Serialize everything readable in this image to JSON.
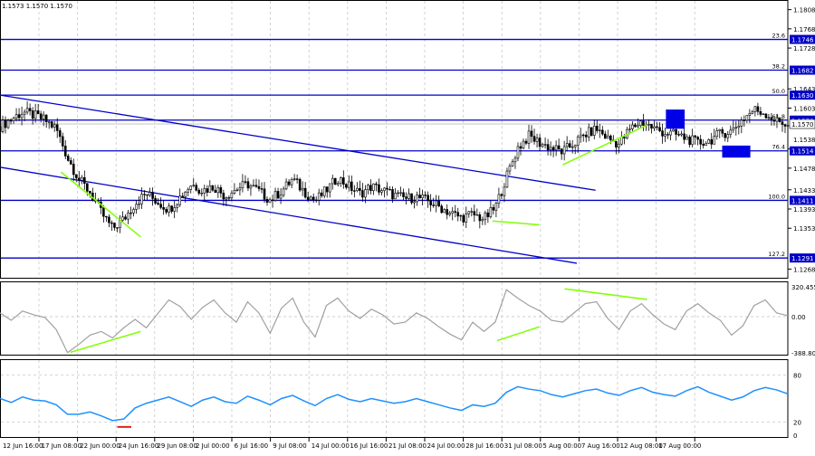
{
  "header": {
    "ohlc": "1.1573 1.1570 1.1570"
  },
  "colors": {
    "price_bar": "#000000",
    "horizontal_level": "#0000c8",
    "channel": "#0000c8",
    "divergence": "#7fff00",
    "cci_line": "#a0a0a0",
    "rsi_line": "#1e90ff",
    "box": "#0000e6",
    "red_marker": "#e02020",
    "grid": "#c8c8c8"
  },
  "chart_data": [
    {
      "type": "candlestick",
      "title": "",
      "xlabel": "",
      "ylabel": "",
      "ylim": [
        1.1248,
        1.1828
      ],
      "y_ticks": [
        "1.1808",
        "1.1768",
        "1.1728",
        "1.1643",
        "1.1603",
        "1.1518",
        "1.1478",
        "1.1433",
        "1.1393",
        "1.1353",
        "1.1268"
      ],
      "x_ticks": [
        "12 Jun 16:00",
        "17 Jun 08:00",
        "22 Jun 00:00",
        "24 Jun 16:00",
        "29 Jun 08:00",
        "2 Jul 00:00",
        "6 Jul 16:00",
        "9 Jul 08:00",
        "14 Jul 00:00",
        "16 Jul 16:00",
        "21 Jul 08:00",
        "24 Jul 00:00",
        "28 Jul 16:00",
        "31 Jul 08:00",
        "5 Aug 00:00",
        "7 Aug 16:00",
        "12 Aug 08:00",
        "17 Aug 00:00"
      ],
      "close_path": [
        [
          0,
          1.1565
        ],
        [
          1.2,
          1.158
        ],
        [
          2.4,
          1.1595
        ],
        [
          3.6,
          1.1588
        ],
        [
          4.8,
          1.1578
        ],
        [
          6,
          1.156
        ],
        [
          7.2,
          1.15
        ],
        [
          8.4,
          1.1455
        ],
        [
          9.6,
          1.1428
        ],
        [
          10.8,
          1.1385
        ],
        [
          12,
          1.1352
        ],
        [
          13.2,
          1.1372
        ],
        [
          14.4,
          1.1405
        ],
        [
          15.6,
          1.1425
        ],
        [
          16.8,
          1.1408
        ],
        [
          18,
          1.1392
        ],
        [
          19.2,
          1.1418
        ],
        [
          20.4,
          1.1445
        ],
        [
          21.6,
          1.1432
        ],
        [
          22.8,
          1.144
        ],
        [
          24,
          1.142
        ],
        [
          25.2,
          1.1435
        ],
        [
          26.4,
          1.1445
        ],
        [
          27.6,
          1.143
        ],
        [
          28.8,
          1.1412
        ],
        [
          30,
          1.143
        ],
        [
          31.2,
          1.1455
        ],
        [
          32.4,
          1.143
        ],
        [
          33.6,
          1.141
        ],
        [
          34.8,
          1.1432
        ],
        [
          36,
          1.1458
        ],
        [
          37.2,
          1.144
        ],
        [
          38.4,
          1.1425
        ],
        [
          39.6,
          1.144
        ],
        [
          40.8,
          1.1432
        ],
        [
          42,
          1.1422
        ],
        [
          43.2,
          1.1415
        ],
        [
          44.4,
          1.1418
        ],
        [
          45.6,
          1.141
        ],
        [
          46.8,
          1.1398
        ],
        [
          48,
          1.1385
        ],
        [
          49.2,
          1.1375
        ],
        [
          50.4,
          1.1382
        ],
        [
          51.6,
          1.1372
        ],
        [
          52.8,
          1.1395
        ],
        [
          54,
          1.146
        ],
        [
          55.2,
          1.152
        ],
        [
          56.4,
          1.1545
        ],
        [
          57.6,
          1.153
        ],
        [
          58.8,
          1.152
        ],
        [
          60,
          1.1512
        ],
        [
          61.2,
          1.153
        ],
        [
          62.4,
          1.1548
        ],
        [
          63.6,
          1.156
        ],
        [
          64.8,
          1.154
        ],
        [
          66,
          1.1528
        ],
        [
          67.2,
          1.156
        ],
        [
          68.4,
          1.1575
        ],
        [
          69.6,
          1.1562
        ],
        [
          70.8,
          1.1552
        ],
        [
          72,
          1.1548
        ],
        [
          73.2,
          1.154
        ],
        [
          74.4,
          1.153
        ],
        [
          75.6,
          1.1535
        ],
        [
          76.8,
          1.155
        ],
        [
          78,
          1.1555
        ],
        [
          79.2,
          1.158
        ],
        [
          80.4,
          1.16
        ],
        [
          81.6,
          1.1592
        ],
        [
          82.8,
          1.1575
        ],
        [
          84,
          1.157
        ]
      ],
      "horizontal_levels": [
        {
          "value": 1.1746,
          "label": "1.1746",
          "fib": "23.6"
        },
        {
          "value": 1.1682,
          "label": "1.1682",
          "fib": "38.2"
        },
        {
          "value": 1.163,
          "label": "1.1630",
          "fib": "50.0"
        },
        {
          "value": 1.1578,
          "label": "1.1578",
          "fib": "61.8"
        },
        {
          "value": 1.1514,
          "label": "1.1514",
          "fib": "76.4"
        },
        {
          "value": 1.1411,
          "label": "1.1411",
          "fib": "100.0"
        },
        {
          "value": 1.1291,
          "label": "1.1291",
          "fib": "127.2"
        }
      ],
      "channel_lines": [
        {
          "from": [
            0,
            1.163
          ],
          "to": [
            63.5,
            1.1432
          ]
        },
        {
          "from": [
            0,
            1.148
          ],
          "to": [
            61.5,
            1.128
          ]
        }
      ],
      "divergence_lines": [
        {
          "from": [
            6.5,
            1.147
          ],
          "to": [
            15,
            1.1335
          ]
        },
        {
          "from": [
            52.5,
            1.1368
          ],
          "to": [
            57.5,
            1.136
          ]
        },
        {
          "from": [
            60,
            1.1485
          ],
          "to": [
            69,
            1.1568
          ]
        }
      ],
      "boxes": [
        {
          "x0": 71,
          "x1": 73,
          "y0": 1.156,
          "y1": 1.16
        },
        {
          "x0": 77,
          "x1": 80,
          "y0": 1.15,
          "y1": 1.1525
        }
      ],
      "current_price": {
        "value": 1.157,
        "label": "1.1570"
      },
      "extra_price_labels": [
        {
          "value": 1.1538,
          "label": "1.1538"
        }
      ]
    },
    {
      "type": "line",
      "title": "",
      "xlabel": "",
      "ylabel": "",
      "ylim": [
        -420,
        380
      ],
      "y_ticks": [
        "320.4558",
        "0.00",
        "-388.803"
      ],
      "series": [
        {
          "values": [
            [
              0,
              40
            ],
            [
              1.2,
              -40
            ],
            [
              2.4,
              60
            ],
            [
              3.6,
              20
            ],
            [
              4.8,
              -10
            ],
            [
              6,
              -140
            ],
            [
              7.2,
              -388
            ],
            [
              8.4,
              -300
            ],
            [
              9.6,
              -200
            ],
            [
              10.8,
              -160
            ],
            [
              12,
              -230
            ],
            [
              13.2,
              -120
            ],
            [
              14.4,
              -30
            ],
            [
              15.6,
              -120
            ],
            [
              16.8,
              30
            ],
            [
              18,
              180
            ],
            [
              19.2,
              110
            ],
            [
              20.4,
              -30
            ],
            [
              21.6,
              100
            ],
            [
              22.8,
              180
            ],
            [
              24,
              40
            ],
            [
              25.2,
              -60
            ],
            [
              26.4,
              160
            ],
            [
              27.6,
              40
            ],
            [
              28.8,
              -180
            ],
            [
              30,
              90
            ],
            [
              31.2,
              200
            ],
            [
              32.4,
              -60
            ],
            [
              33.6,
              -220
            ],
            [
              34.8,
              120
            ],
            [
              36,
              200
            ],
            [
              37.2,
              60
            ],
            [
              38.4,
              -20
            ],
            [
              39.6,
              80
            ],
            [
              40.8,
              20
            ],
            [
              42,
              -80
            ],
            [
              43.2,
              -60
            ],
            [
              44.4,
              40
            ],
            [
              45.6,
              -20
            ],
            [
              46.8,
              -110
            ],
            [
              48,
              -190
            ],
            [
              49.2,
              -250
            ],
            [
              50.4,
              -60
            ],
            [
              51.6,
              -160
            ],
            [
              52.8,
              -60
            ],
            [
              54,
              290
            ],
            [
              55.2,
              200
            ],
            [
              56.4,
              120
            ],
            [
              57.6,
              60
            ],
            [
              58.8,
              -40
            ],
            [
              60,
              -60
            ],
            [
              61.2,
              40
            ],
            [
              62.4,
              140
            ],
            [
              63.6,
              160
            ],
            [
              64.8,
              -20
            ],
            [
              66,
              -140
            ],
            [
              67.2,
              60
            ],
            [
              68.4,
              140
            ],
            [
              69.6,
              20
            ],
            [
              70.8,
              -80
            ],
            [
              72,
              -140
            ],
            [
              73.2,
              60
            ],
            [
              74.4,
              140
            ],
            [
              75.6,
              40
            ],
            [
              76.8,
              -40
            ],
            [
              78,
              -200
            ],
            [
              79.2,
              -100
            ],
            [
              80.4,
              120
            ],
            [
              81.6,
              180
            ],
            [
              82.8,
              40
            ],
            [
              84,
              10
            ]
          ]
        }
      ],
      "divergence_lines": [
        {
          "from": [
            7.5,
            -385
          ],
          "to": [
            15,
            -160
          ]
        },
        {
          "from": [
            53,
            -260
          ],
          "to": [
            57.5,
            -110
          ]
        },
        {
          "from": [
            60.2,
            300
          ],
          "to": [
            69,
            185
          ]
        }
      ]
    },
    {
      "type": "line",
      "title": "",
      "xlabel": "",
      "ylabel": "",
      "ylim": [
        0,
        100
      ],
      "y_ticks": [
        "80",
        "20",
        "0"
      ],
      "series": [
        {
          "values": [
            [
              0,
              50
            ],
            [
              1.2,
              45
            ],
            [
              2.4,
              52
            ],
            [
              3.6,
              48
            ],
            [
              4.8,
              47
            ],
            [
              6,
              42
            ],
            [
              7.2,
              30
            ],
            [
              8.4,
              30
            ],
            [
              9.6,
              33
            ],
            [
              10.8,
              28
            ],
            [
              12,
              22
            ],
            [
              13.2,
              24
            ],
            [
              14.4,
              38
            ],
            [
              15.6,
              44
            ],
            [
              16.8,
              48
            ],
            [
              18,
              52
            ],
            [
              19.2,
              46
            ],
            [
              20.4,
              40
            ],
            [
              21.6,
              48
            ],
            [
              22.8,
              52
            ],
            [
              24,
              46
            ],
            [
              25.2,
              44
            ],
            [
              26.4,
              53
            ],
            [
              27.6,
              48
            ],
            [
              28.8,
              42
            ],
            [
              30,
              50
            ],
            [
              31.2,
              54
            ],
            [
              32.4,
              47
            ],
            [
              33.6,
              41
            ],
            [
              34.8,
              50
            ],
            [
              36,
              55
            ],
            [
              37.2,
              49
            ],
            [
              38.4,
              46
            ],
            [
              39.6,
              50
            ],
            [
              40.8,
              47
            ],
            [
              42,
              44
            ],
            [
              43.2,
              46
            ],
            [
              44.4,
              50
            ],
            [
              45.6,
              46
            ],
            [
              46.8,
              42
            ],
            [
              48,
              38
            ],
            [
              49.2,
              35
            ],
            [
              50.4,
              42
            ],
            [
              51.6,
              40
            ],
            [
              52.8,
              44
            ],
            [
              54,
              58
            ],
            [
              55.2,
              65
            ],
            [
              56.4,
              62
            ],
            [
              57.6,
              60
            ],
            [
              58.8,
              55
            ],
            [
              60,
              52
            ],
            [
              61.2,
              56
            ],
            [
              62.4,
              60
            ],
            [
              63.6,
              62
            ],
            [
              64.8,
              57
            ],
            [
              66,
              54
            ],
            [
              67.2,
              60
            ],
            [
              68.4,
              64
            ],
            [
              69.6,
              58
            ],
            [
              70.8,
              55
            ],
            [
              72,
              53
            ],
            [
              73.2,
              60
            ],
            [
              74.4,
              65
            ],
            [
              75.6,
              58
            ],
            [
              76.8,
              53
            ],
            [
              78,
              48
            ],
            [
              79.2,
              52
            ],
            [
              80.4,
              60
            ],
            [
              81.6,
              64
            ],
            [
              82.8,
              61
            ],
            [
              84,
              56
            ]
          ]
        }
      ],
      "markers": [
        {
          "from": [
            12.5,
            22
          ],
          "to": [
            14,
            22
          ]
        }
      ]
    }
  ]
}
